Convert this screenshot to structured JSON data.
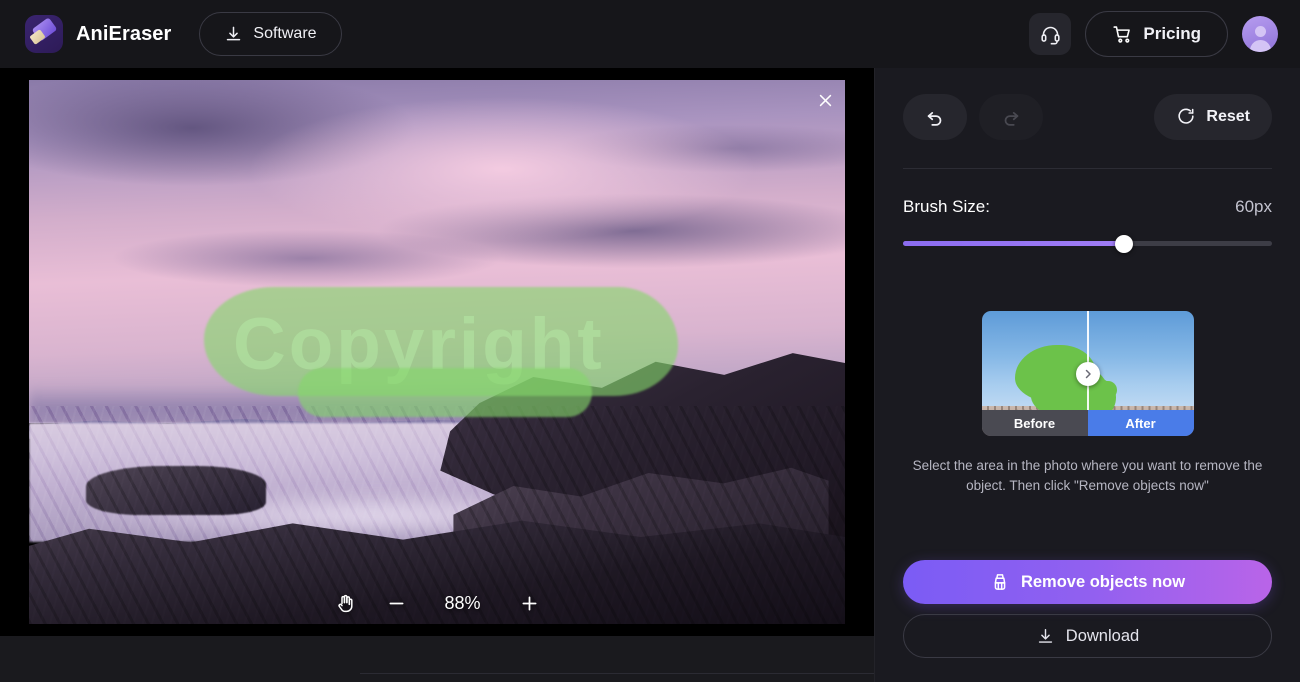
{
  "header": {
    "brand_name": "AniEraser",
    "software_label": "Software",
    "pricing_label": "Pricing",
    "support_icon": "headset-icon",
    "cart_icon": "cart-icon",
    "download_icon": "download-icon",
    "avatar_icon": "user-avatar-icon"
  },
  "canvas": {
    "close_icon": "close-icon",
    "watermark_text": "Copyright",
    "pan_tool_icon": "hand-pan-icon",
    "zoom_out_label": "−",
    "zoom_level": "88%",
    "zoom_in_label": "+"
  },
  "panel": {
    "undo_icon": "undo-icon",
    "redo_icon": "redo-icon",
    "reset_label": "Reset",
    "reset_icon": "reset-circular-arrow-icon",
    "brush_size_label": "Brush Size:",
    "brush_size_value": "60px",
    "brush_slider_percent": 60,
    "preview": {
      "before_label": "Before",
      "after_label": "After",
      "handle_icon": "chevron-right-icon"
    },
    "hint_text": "Select the area in the photo where you want to remove the object. Then click \"Remove objects now\"",
    "remove_button_label": "Remove objects now",
    "remove_button_icon": "brush-clean-icon",
    "download_button_label": "Download",
    "download_button_icon": "download-icon"
  },
  "colors": {
    "accent_violet": "#7b5cf5",
    "accent_pink": "#b964e8",
    "panel_bg": "#1a1a20",
    "header_bg": "#16161a",
    "mask_green": "#84d66a",
    "after_blue": "#4a7ce8"
  }
}
